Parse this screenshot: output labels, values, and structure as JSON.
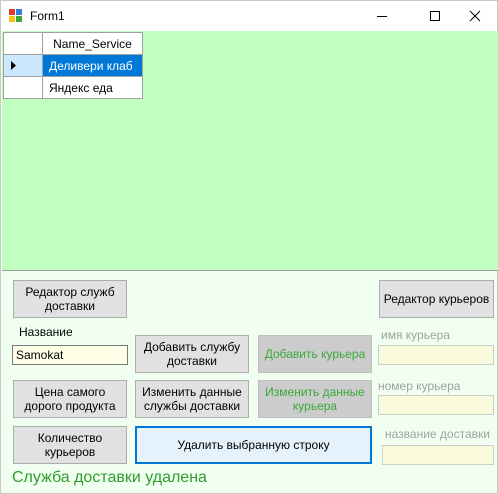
{
  "window": {
    "title": "Form1"
  },
  "grid": {
    "column_header": "Name_Service",
    "rows": [
      "Деливери клаб",
      "Яндекс еда"
    ],
    "selected_row": 0
  },
  "buttons": {
    "services_editor": "Редактор служб доставки",
    "couriers_editor": "Редактор курьеров",
    "add_service": "Добавить службу доставки",
    "add_courier": "Добавить курьера",
    "most_expensive": "Цена самого дорого продукта",
    "edit_service": "Изменить данные службы доставки",
    "edit_courier": "Изменить данные курьера",
    "couriers_count": "Количество курьеров",
    "delete_row": "Удалить выбранную строку"
  },
  "labels": {
    "name": "Название",
    "courier_name": "имя курьера",
    "courier_number": "номер курьера",
    "delivery_name": "название доставки"
  },
  "inputs": {
    "name_value": "Samokat",
    "courier_name_value": "",
    "courier_number_value": "",
    "delivery_name_value": ""
  },
  "status": "Служба доставки удалена",
  "colors": {
    "grid_background": "#c0ffc0",
    "form_background": "#f0fff0",
    "selection": "#0078d7",
    "status_text": "#2f9e2f",
    "disabled_text": "#3aa83a"
  }
}
